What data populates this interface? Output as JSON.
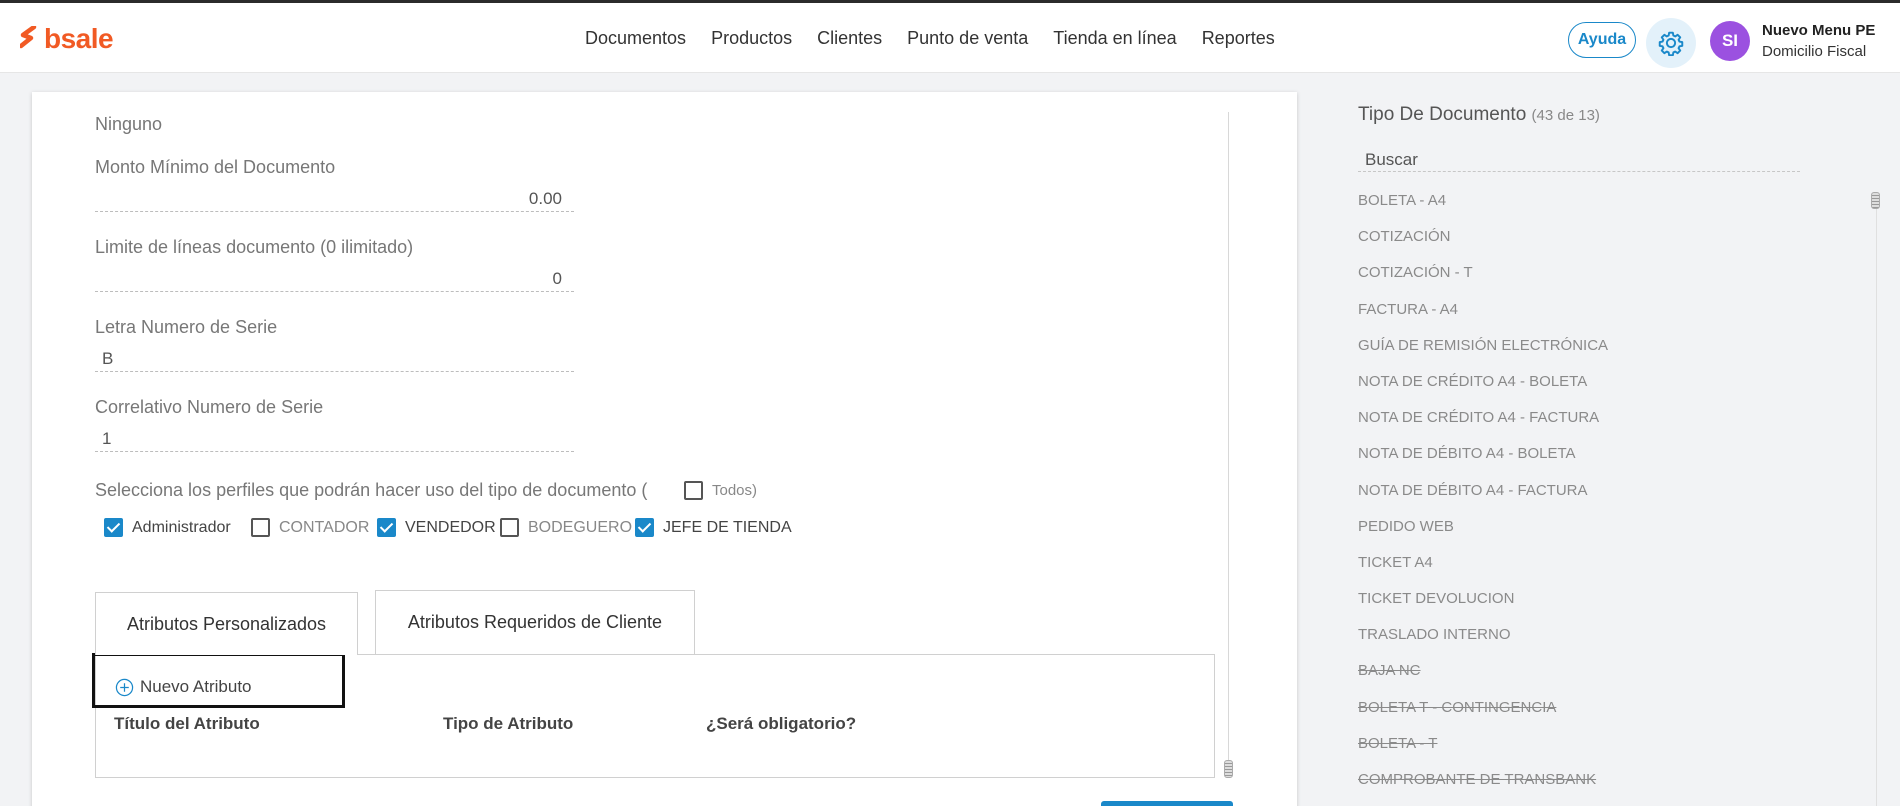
{
  "brand": {
    "name": "bsale",
    "color": "#f15a24"
  },
  "nav": {
    "items": [
      "Documentos",
      "Productos",
      "Clientes",
      "Punto de venta",
      "Tienda en línea",
      "Reportes"
    ]
  },
  "header": {
    "help_label": "Ayuda",
    "settings_icon": "gear-icon",
    "avatar_initials": "SI",
    "user_name": "Nuevo Menu PE",
    "user_location": "Domicilio Fiscal"
  },
  "form": {
    "top_value": "Ninguno",
    "min_amount": {
      "label": "Monto Mínimo del Documento",
      "value": "0.00"
    },
    "line_limit": {
      "label": "Limite de líneas documento (0 ilimitado)",
      "value": "0"
    },
    "series_letter": {
      "label": "Letra Numero de Serie",
      "value": "B"
    },
    "series_correlative": {
      "label": "Correlativo Numero de Serie",
      "value": "1"
    },
    "profiles": {
      "prompt": "Selecciona los perfiles que podrán hacer uso del tipo de documento (",
      "all_label": "Todos)",
      "all_checked": false,
      "items": [
        {
          "label": "Administrador",
          "checked": true
        },
        {
          "label": "CONTADOR",
          "checked": false
        },
        {
          "label": "VENDEDOR",
          "checked": true
        },
        {
          "label": "BODEGUERO",
          "checked": false
        },
        {
          "label": "JEFE DE TIENDA",
          "checked": true
        }
      ]
    }
  },
  "tabs": {
    "items": [
      "Atributos Personalizados",
      "Atributos Requeridos de Cliente"
    ],
    "active_index": 0
  },
  "attributes": {
    "new_label": "Nuevo Atributo",
    "columns": [
      "Título del Atributo",
      "Tipo de Atributo",
      "¿Será obligatorio?"
    ]
  },
  "sidebar": {
    "title": "Tipo De Documento",
    "count": "(43 de 13)",
    "search_placeholder": "Buscar",
    "documents": [
      {
        "name": "BOLETA - A4",
        "inactive": false
      },
      {
        "name": "COTIZACIÓN",
        "inactive": false
      },
      {
        "name": "COTIZACIÓN - T",
        "inactive": false
      },
      {
        "name": "FACTURA - A4",
        "inactive": false
      },
      {
        "name": "GUÍA DE REMISIÓN ELECTRÓNICA",
        "inactive": false
      },
      {
        "name": "NOTA DE CRÉDITO A4 - BOLETA",
        "inactive": false
      },
      {
        "name": "NOTA DE CRÉDITO A4 - FACTURA",
        "inactive": false
      },
      {
        "name": "NOTA DE DÉBITO A4 - BOLETA",
        "inactive": false
      },
      {
        "name": "NOTA DE DÉBITO A4 - FACTURA",
        "inactive": false
      },
      {
        "name": "PEDIDO WEB",
        "inactive": false
      },
      {
        "name": "TICKET A4",
        "inactive": false
      },
      {
        "name": "TICKET DEVOLUCION",
        "inactive": false
      },
      {
        "name": "TRASLADO INTERNO",
        "inactive": false
      },
      {
        "name": "BAJA NC",
        "inactive": true
      },
      {
        "name": "BOLETA T - CONTINGENCIA",
        "inactive": true
      },
      {
        "name": "BOLETA - T",
        "inactive": true
      },
      {
        "name": "COMPROBANTE DE TRANSBANK",
        "inactive": true
      }
    ]
  },
  "colors": {
    "accent": "#1a88c9",
    "avatar": "#9b51e0"
  }
}
